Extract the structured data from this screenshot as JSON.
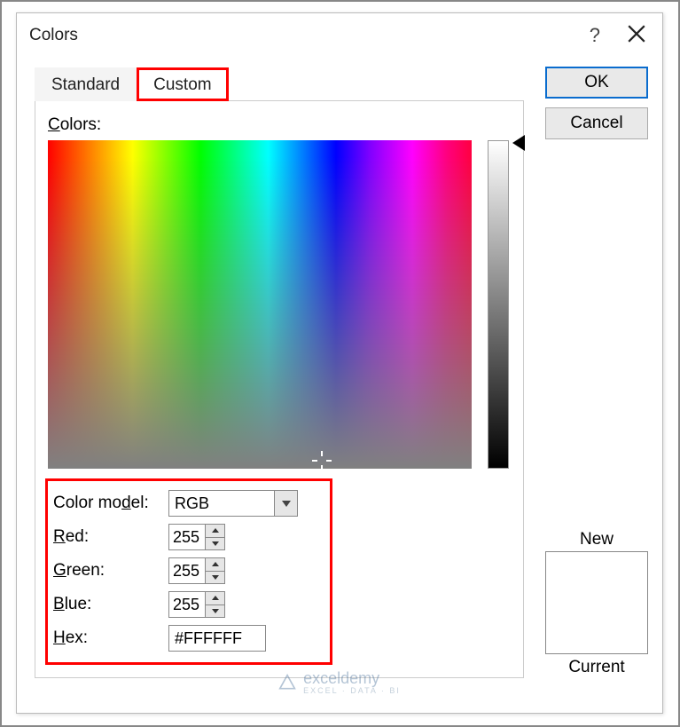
{
  "dialog": {
    "title": "Colors"
  },
  "buttons": {
    "ok": "OK",
    "cancel": "Cancel",
    "help": "?"
  },
  "tabs": {
    "standard": "Standard",
    "custom": "Custom"
  },
  "labels": {
    "colors": "Colors:",
    "color_model": "Color model:",
    "red": "Red:",
    "green": "Green:",
    "blue": "Blue:",
    "hex": "Hex:",
    "new": "New",
    "current": "Current"
  },
  "values": {
    "color_model": "RGB",
    "red": "255",
    "green": "255",
    "blue": "255",
    "hex": "#FFFFFF",
    "new_color": "#FFFFFF",
    "current_color": "#FFFFFF"
  },
  "highlights": {
    "custom_tab": true,
    "form_box": true
  },
  "watermark": {
    "brand": "exceldemy",
    "tagline": "EXCEL · DATA · BI"
  }
}
